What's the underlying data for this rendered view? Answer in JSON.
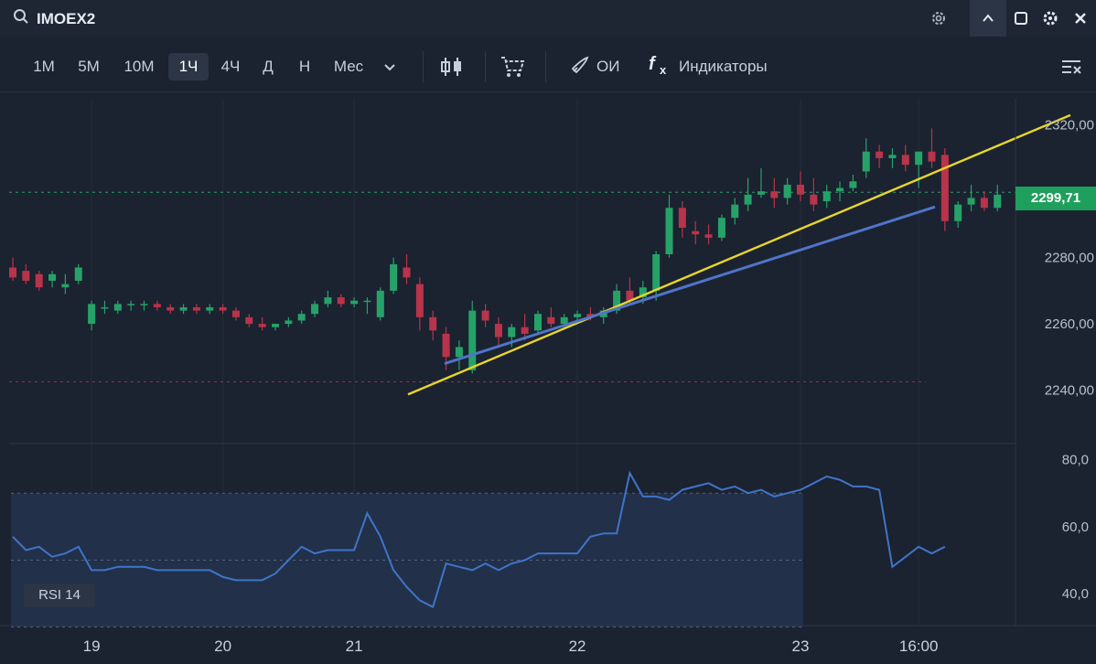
{
  "header": {
    "ticker": "IMOEX2",
    "icons": [
      "search-icon",
      "settings-gear-icon",
      "collapse-chevron-icon",
      "window-restore-icon",
      "gear-icon",
      "close-icon"
    ]
  },
  "toolbar": {
    "timeframes": [
      "1М",
      "5М",
      "10М",
      "1Ч",
      "4Ч",
      "Д",
      "Н",
      "Мес"
    ],
    "active_timeframe": "1Ч",
    "oi_label": "ОИ",
    "indicators_label": "Индикаторы",
    "icons": [
      "dropdown-chevron-icon",
      "candles-icon",
      "cart-icon",
      "rocket-icon",
      "function-icon",
      "menu-lines-icon"
    ]
  },
  "colors": {
    "up": "#26a269",
    "down": "#b8344a",
    "yellow_line": "#e8d629",
    "blue_line": "#4f74c8",
    "rsi_line": "#3f74c9",
    "price_tag": "#1f9f5c"
  },
  "chart_data": [
    {
      "type": "candlestick",
      "symbol": "IMOEX2",
      "interval": "1Ч",
      "ylim": [
        2228,
        2326
      ],
      "y_ticks": [
        "2320,00",
        "2300,00",
        "2280,00",
        "2260,00",
        "2240,00"
      ],
      "y_tick_values": [
        2320,
        2300,
        2280,
        2260,
        2240
      ],
      "x_ticks": [
        "19",
        "20",
        "21",
        "22",
        "23",
        "16:00"
      ],
      "x_tick_index": [
        6,
        16,
        26,
        43,
        60,
        69
      ],
      "last_price": 2299.71,
      "last_price_label": "2299,71",
      "candles": [
        [
          2277,
          2280,
          2273,
          2274
        ],
        [
          2276,
          2278,
          2272,
          2273
        ],
        [
          2275,
          2276,
          2270,
          2271
        ],
        [
          2273,
          2276,
          2271,
          2275
        ],
        [
          2271,
          2275,
          2269,
          2272
        ],
        [
          2273,
          2278,
          2272,
          2277
        ],
        [
          2260,
          2267,
          2258,
          2266
        ],
        [
          2265,
          2267,
          2263,
          2265
        ],
        [
          2264,
          2267,
          2263,
          2266
        ],
        [
          2266,
          2267,
          2264,
          2266
        ],
        [
          2266,
          2267,
          2264,
          2266
        ],
        [
          2266,
          2267,
          2264,
          2265
        ],
        [
          2265,
          2266,
          2263,
          2264
        ],
        [
          2264,
          2266,
          2263,
          2265
        ],
        [
          2265,
          2266,
          2263,
          2264
        ],
        [
          2264,
          2266,
          2263,
          2265
        ],
        [
          2265,
          2266,
          2263,
          2264
        ],
        [
          2264,
          2265,
          2261,
          2262
        ],
        [
          2262,
          2263,
          2259,
          2260
        ],
        [
          2260,
          2262,
          2258,
          2259
        ],
        [
          2259,
          2260,
          2258,
          2260
        ],
        [
          2260,
          2262,
          2259,
          2261
        ],
        [
          2261,
          2264,
          2260,
          2263
        ],
        [
          2263,
          2267,
          2262,
          2266
        ],
        [
          2266,
          2270,
          2265,
          2268
        ],
        [
          2268,
          2269,
          2265,
          2266
        ],
        [
          2266,
          2268,
          2265,
          2267
        ],
        [
          2267,
          2268,
          2263,
          2267
        ],
        [
          2262,
          2271,
          2261,
          2270
        ],
        [
          2270,
          2280,
          2269,
          2278
        ],
        [
          2277,
          2281,
          2272,
          2274
        ],
        [
          2272,
          2274,
          2258,
          2262
        ],
        [
          2262,
          2264,
          2255,
          2258
        ],
        [
          2257,
          2259,
          2246,
          2250
        ],
        [
          2250,
          2255,
          2246,
          2253
        ],
        [
          2246,
          2267,
          2245,
          2264
        ],
        [
          2264,
          2266,
          2259,
          2261
        ],
        [
          2260,
          2262,
          2253,
          2256
        ],
        [
          2256,
          2260,
          2253,
          2259
        ],
        [
          2259,
          2263,
          2255,
          2257
        ],
        [
          2258,
          2264,
          2257,
          2263
        ],
        [
          2262,
          2265,
          2259,
          2260
        ],
        [
          2260,
          2263,
          2259,
          2262
        ],
        [
          2262,
          2264,
          2261,
          2263
        ],
        [
          2263,
          2265,
          2261,
          2262
        ],
        [
          2262,
          2265,
          2260,
          2264
        ],
        [
          2264,
          2272,
          2263,
          2270
        ],
        [
          2270,
          2274,
          2266,
          2267
        ],
        [
          2268,
          2273,
          2266,
          2271
        ],
        [
          2270,
          2282,
          2267,
          2281
        ],
        [
          2281,
          2299,
          2280,
          2295
        ],
        [
          2295,
          2297,
          2286,
          2289
        ],
        [
          2288,
          2291,
          2284,
          2287
        ],
        [
          2287,
          2290,
          2284,
          2286
        ],
        [
          2286,
          2293,
          2285,
          2292
        ],
        [
          2292,
          2298,
          2290,
          2296
        ],
        [
          2296,
          2304,
          2294,
          2299
        ],
        [
          2299,
          2307,
          2298,
          2300
        ],
        [
          2300,
          2304,
          2295,
          2298
        ],
        [
          2298,
          2304,
          2296,
          2302
        ],
        [
          2302,
          2306,
          2297,
          2299
        ],
        [
          2299,
          2304,
          2294,
          2296
        ],
        [
          2297,
          2302,
          2295,
          2300
        ],
        [
          2300,
          2303,
          2297,
          2301
        ],
        [
          2301,
          2305,
          2300,
          2303
        ],
        [
          2306,
          2316,
          2304,
          2312
        ],
        [
          2312,
          2314,
          2307,
          2310
        ],
        [
          2310,
          2313,
          2307,
          2311
        ],
        [
          2311,
          2314,
          2306,
          2308
        ],
        [
          2308,
          2312,
          2301,
          2312
        ],
        [
          2312,
          2319,
          2307,
          2309
        ],
        [
          2311,
          2313,
          2288,
          2291
        ],
        [
          2291,
          2297,
          2289,
          2296
        ],
        [
          2296,
          2302,
          2294,
          2298
        ],
        [
          2298,
          2300,
          2294,
          2295
        ],
        [
          2295,
          2302,
          2294,
          2299
        ]
      ],
      "series": [
        {
          "color": "#e8d629",
          "line": [
            [
              0,
              2238.7
            ],
            [
              1,
              2323.0
            ]
          ]
        },
        {
          "color": "#4f74c8",
          "line": [
            [
              0,
              2248.0
            ],
            [
              1,
              2295.3
            ]
          ]
        }
      ],
      "reference_levels": [
        2299.71,
        2242.5
      ]
    },
    {
      "type": "line",
      "title": "RSI 14",
      "ylim": [
        31,
        84
      ],
      "y_ticks": [
        "80,0",
        "60,0",
        "40,0"
      ],
      "y_tick_values": [
        80,
        60,
        40
      ],
      "bands": [
        70,
        50,
        30
      ],
      "values": [
        57,
        53,
        54,
        51,
        52,
        54,
        47,
        47,
        48,
        48,
        48,
        47,
        47,
        47,
        47,
        47,
        45,
        44,
        44,
        44,
        46,
        50,
        54,
        52,
        53,
        53,
        53,
        64,
        57,
        47,
        42,
        38,
        36,
        49,
        48,
        47,
        49,
        47,
        49,
        50,
        52,
        52,
        52,
        52,
        57,
        58,
        58,
        76,
        69,
        69,
        68,
        71,
        72,
        73,
        71,
        72,
        70,
        71,
        69,
        70,
        71,
        73,
        75,
        74,
        72,
        72,
        71,
        48,
        51,
        54,
        52,
        54
      ]
    }
  ]
}
